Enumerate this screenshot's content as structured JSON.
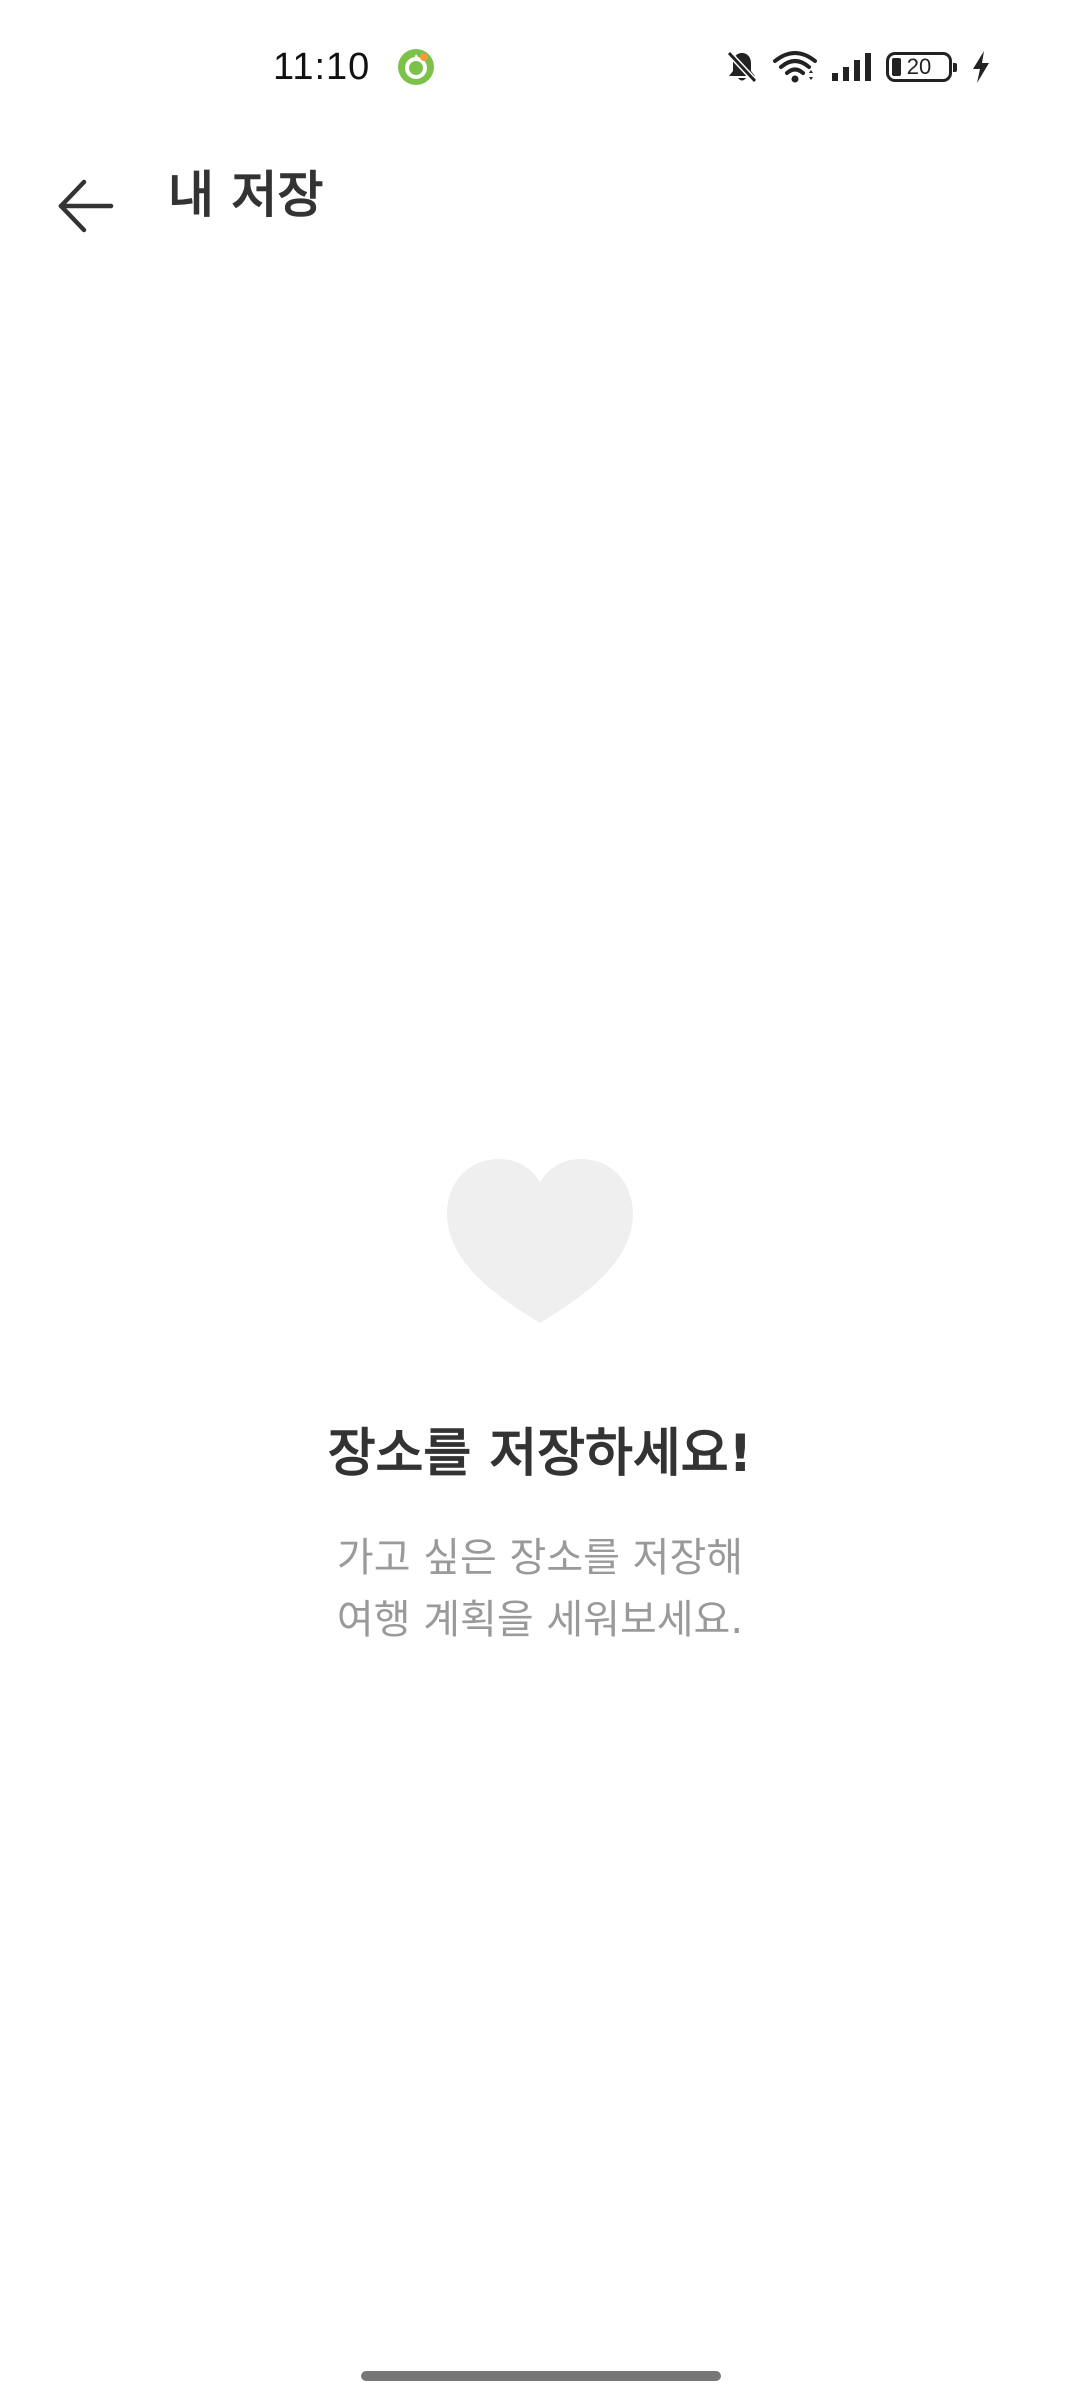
{
  "status_bar": {
    "time": "11:10",
    "battery_level": "20",
    "icons": [
      "app-notification-icon",
      "bell-off-icon",
      "wifi-icon",
      "cell-signal-icon",
      "battery-icon",
      "charging-icon"
    ]
  },
  "app_bar": {
    "back_icon": "arrow-left-icon",
    "title": "내 저장"
  },
  "empty_state": {
    "icon": "heart-icon",
    "title": "장소를 저장하세요!",
    "description_line1": "가고 싶은 장소를 저장해",
    "description_line2": "여행 계획을 세워보세요."
  },
  "colors": {
    "title_text": "#333333",
    "secondary_text": "#9a9a9a",
    "heart_fill": "#efefef",
    "app_icon_accent": "#7cc24a",
    "home_indicator": "#777777"
  }
}
